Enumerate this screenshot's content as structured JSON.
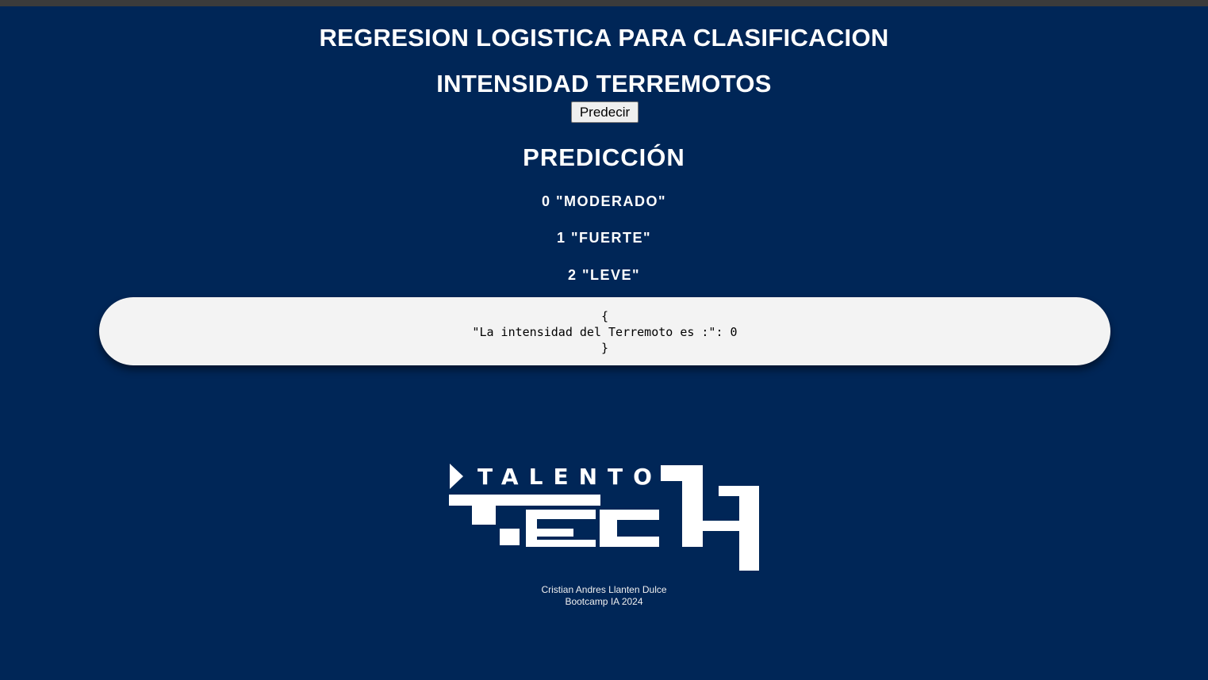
{
  "header": {
    "title_line1": "REGRESION LOGISTICA PARA CLASIFICACION",
    "title_line2": "INTENSIDAD TERREMOTOS"
  },
  "form": {
    "predict_button_label": "Predecir"
  },
  "prediction": {
    "heading": "PREDICCIÓN",
    "classes": [
      "0 \"MODERADO\"",
      "1 \"FUERTE\"",
      "2 \"LEVE\""
    ],
    "result": {
      "open": "{",
      "body": "\"La intensidad del Terremoto es :\": 0",
      "close": "}"
    }
  },
  "logo": {
    "text_top": "TALENTO",
    "text_bottom": "TECH",
    "color": "#ffffff"
  },
  "footer": {
    "author": "Cristian Andres Llanten Dulce",
    "event": "Bootcamp IA 2024"
  },
  "colors": {
    "background": "#002657",
    "result_box": "#f3f3f3"
  }
}
